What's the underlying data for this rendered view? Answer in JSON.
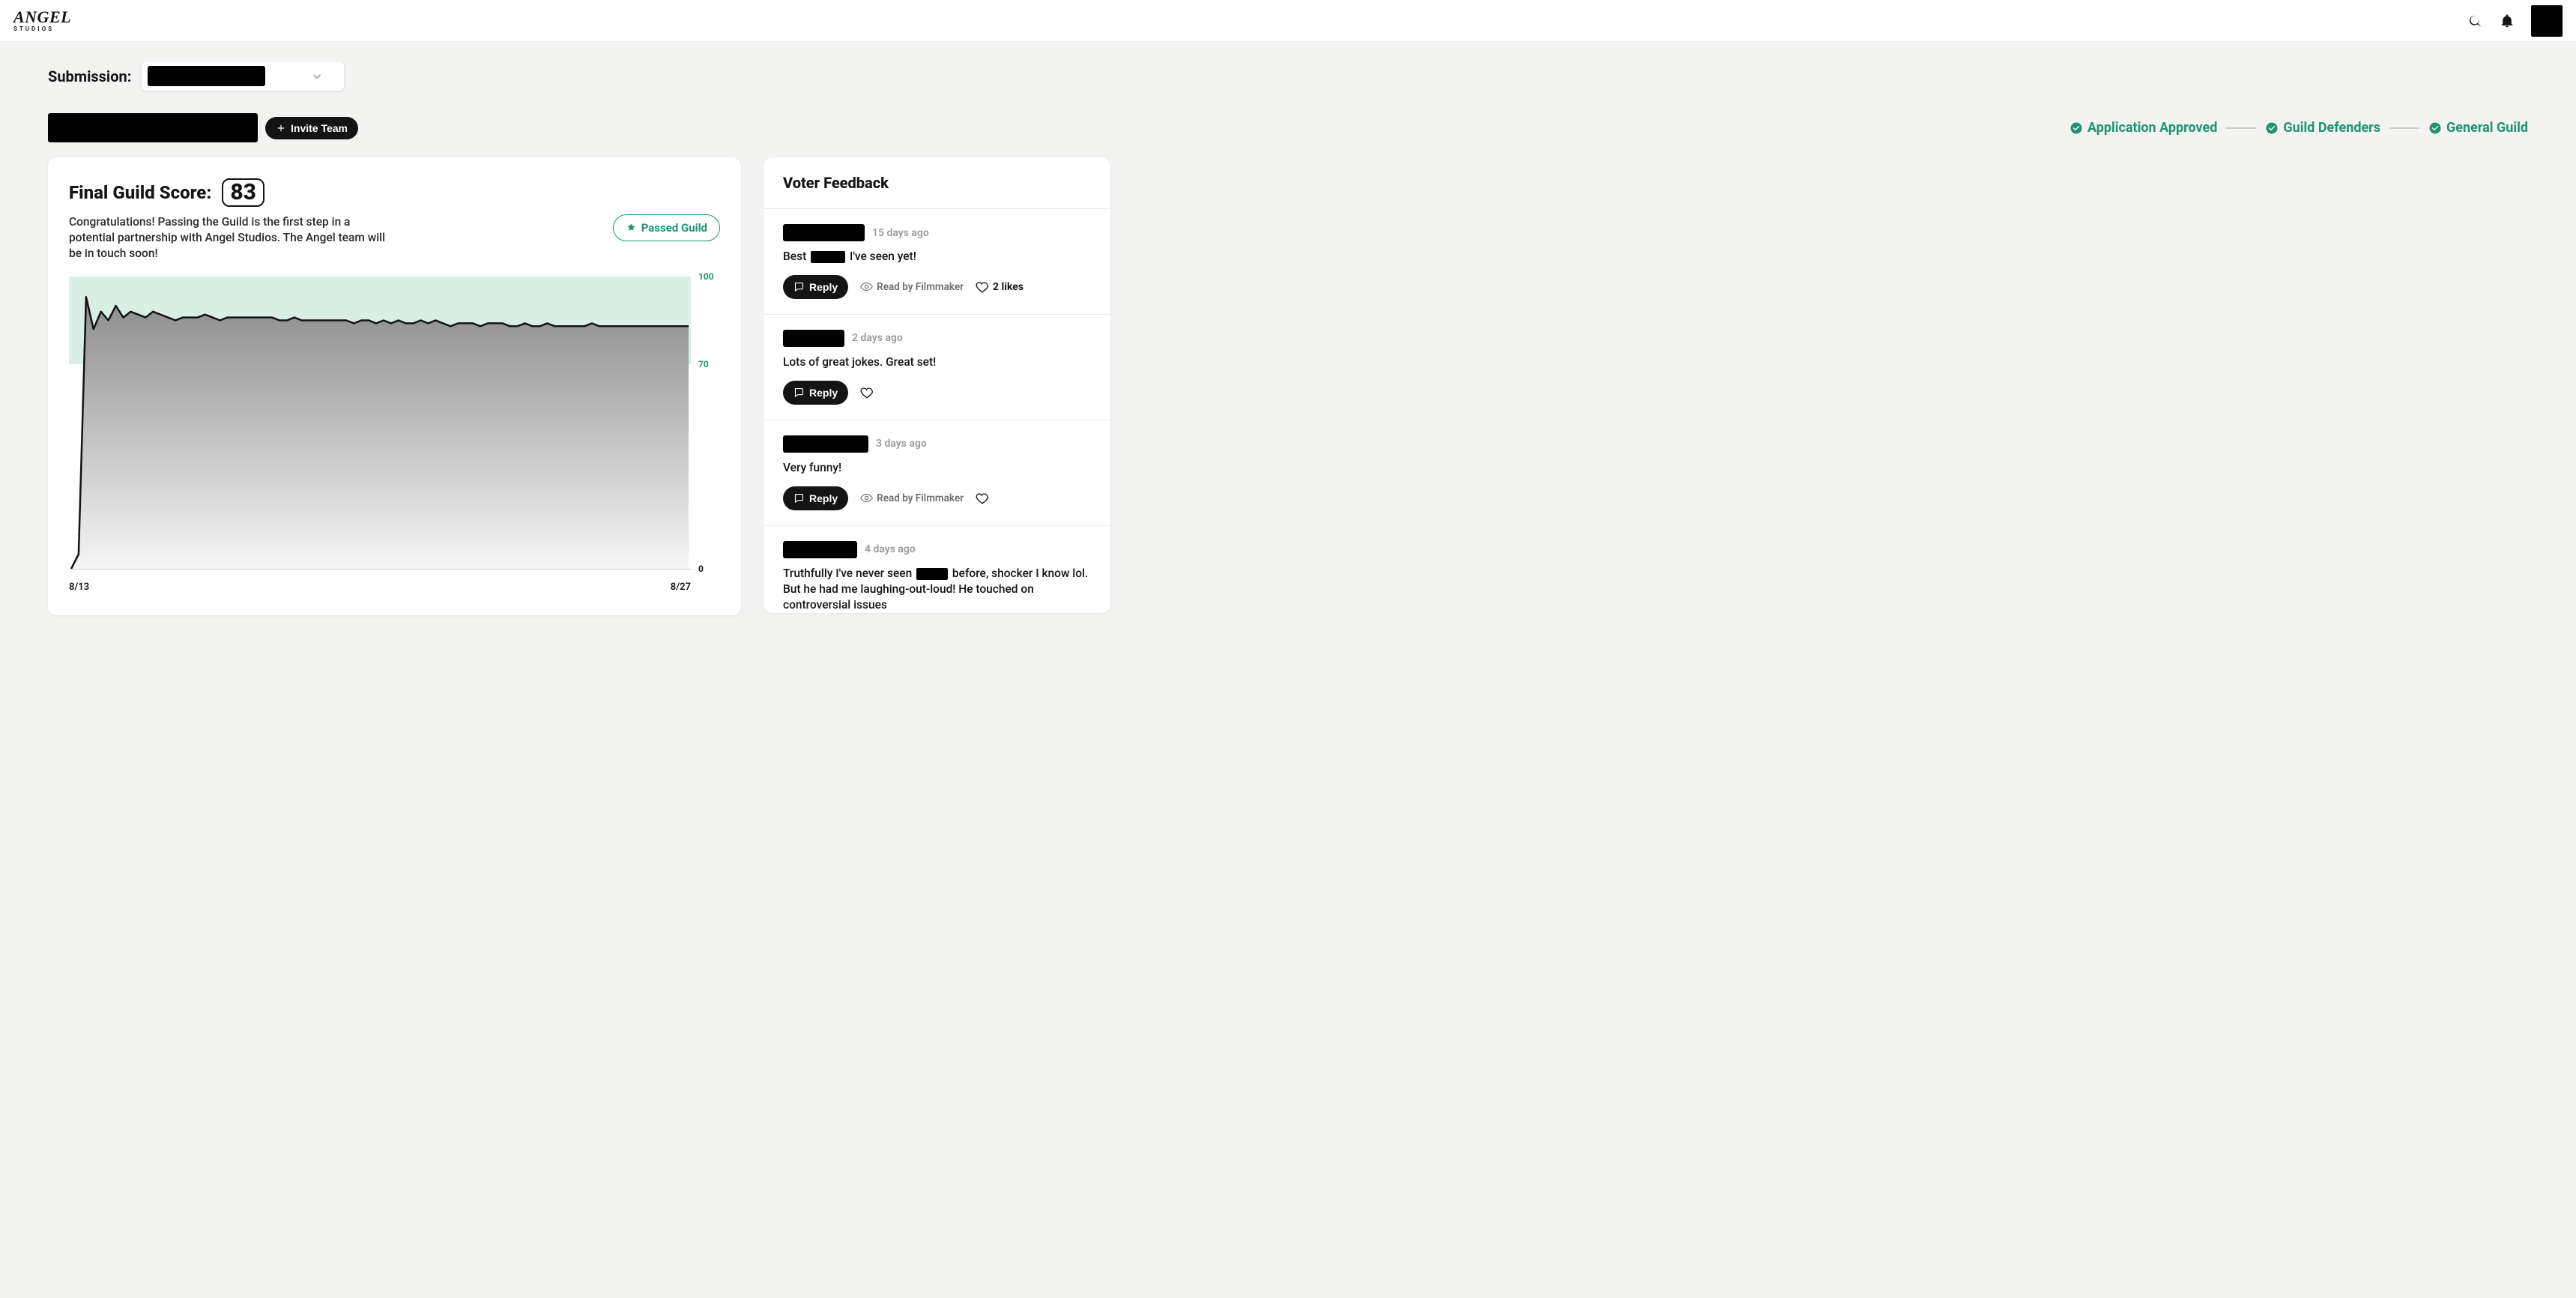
{
  "header": {
    "logo_main": "ANGEL",
    "logo_sub": "STUDIOS"
  },
  "submission": {
    "label": "Submission:"
  },
  "invite_button": "Invite Team",
  "steps": [
    "Application Approved",
    "Guild Defenders",
    "General Guild"
  ],
  "score": {
    "title": "Final Guild Score:",
    "value": "83",
    "description": "Congratulations! Passing the Guild is the first step in a potential partnership with Angel Studios. The Angel team will be in touch soon!",
    "passed_label": "Passed Guild"
  },
  "chart_data": {
    "type": "line",
    "x_start_label": "8/13",
    "x_end_label": "8/27",
    "ylim": [
      0,
      100
    ],
    "yticks": [
      100,
      70,
      0
    ],
    "threshold": 70,
    "values": [
      0,
      5,
      93,
      82,
      88,
      85,
      90,
      86,
      88,
      87,
      86,
      88,
      87,
      86,
      85,
      86,
      86,
      86,
      87,
      86,
      85,
      86,
      86,
      86,
      86,
      86,
      86,
      86,
      85,
      85,
      86,
      85,
      85,
      85,
      85,
      85,
      85,
      85,
      84,
      85,
      85,
      84,
      85,
      84,
      85,
      84,
      84,
      85,
      84,
      85,
      84,
      83,
      84,
      84,
      84,
      83,
      84,
      84,
      84,
      83,
      83,
      84,
      83,
      83,
      84,
      83,
      83,
      83,
      83,
      83,
      84,
      83,
      83,
      83,
      83,
      83,
      83,
      83,
      83,
      83,
      83,
      83,
      83,
      83
    ]
  },
  "feedback": {
    "title": "Voter Feedback",
    "read_by_label": "Read by Filmmaker",
    "reply_label": "Reply",
    "comments": [
      {
        "name_width": 109,
        "time": "15 days ago",
        "text_before": "Best ",
        "redact_width": 46,
        "text_after": " I've seen yet!",
        "read_by": true,
        "likes": "2 likes"
      },
      {
        "name_width": 82,
        "time": "2 days ago",
        "text_plain": "Lots of great jokes. Great set!",
        "read_by": false,
        "likes": ""
      },
      {
        "name_width": 114,
        "time": "3 days ago",
        "text_plain": "Very funny!",
        "read_by": true,
        "likes": ""
      },
      {
        "name_width": 99,
        "time": "4 days ago",
        "text4_p1": "Truthfully I've never seen",
        "text4_r1_width": 42,
        "text4_p2": "before, shocker I know lol. But he had me laughing-out-loud! He touched on controversial issues"
      }
    ]
  }
}
